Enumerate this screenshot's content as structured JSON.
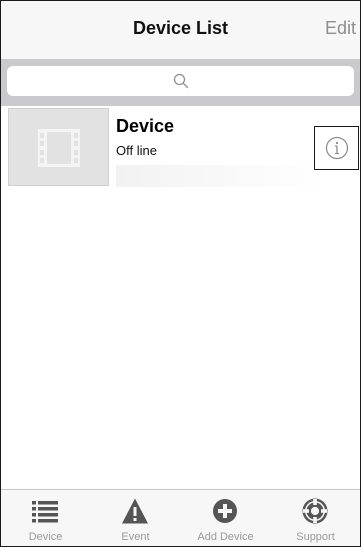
{
  "navbar": {
    "title": "Device List",
    "edit_label": "Edit"
  },
  "search": {
    "placeholder": ""
  },
  "devices": [
    {
      "name": "Device",
      "status": "Off line",
      "thumbnail_icon": "film-icon",
      "info_icon": "info-icon"
    }
  ],
  "tabbar": {
    "tabs": [
      {
        "label": "Device",
        "icon": "list-icon"
      },
      {
        "label": "Event",
        "icon": "warning-icon"
      },
      {
        "label": "Add Device",
        "icon": "add-circle-icon"
      },
      {
        "label": "Support",
        "icon": "lifebuoy-icon"
      }
    ]
  },
  "colors": {
    "navbar_bg": "#f7f7f7",
    "search_band": "#c9c9ce",
    "thumb_bg": "#e2e2e2",
    "icon_gray": "#9a9a9a",
    "tab_icon_dark": "#555555"
  }
}
